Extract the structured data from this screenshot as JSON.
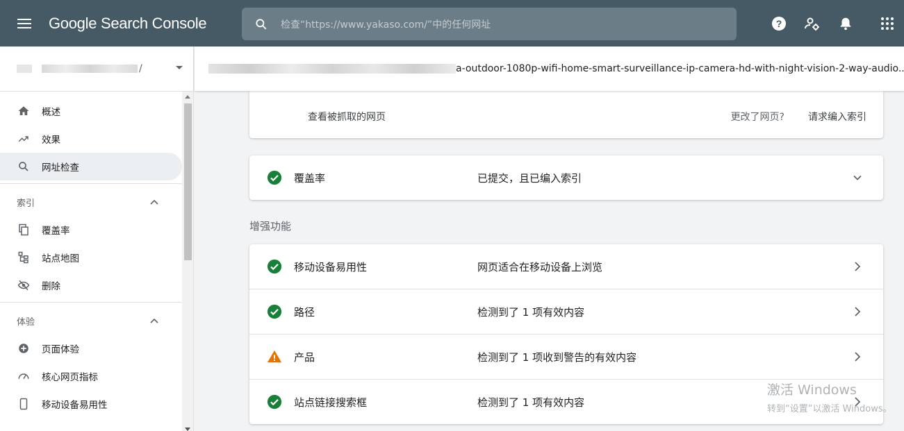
{
  "app": {
    "title": "Google Search Console",
    "search_placeholder": "检查“https://www.yakaso.com/”中的任何网址"
  },
  "property": {
    "suffix": "/"
  },
  "nav": {
    "top_items": [
      {
        "label": "概述",
        "icon": "home-icon"
      },
      {
        "label": "效果",
        "icon": "trending-up-icon"
      },
      {
        "label": "网址检查",
        "icon": "search-icon",
        "active": true
      }
    ],
    "sections": [
      {
        "title": "索引",
        "items": [
          {
            "label": "覆盖率",
            "icon": "copy-icon"
          },
          {
            "label": "站点地图",
            "icon": "sitemap-icon"
          },
          {
            "label": "删除",
            "icon": "visibility-off-icon"
          }
        ]
      },
      {
        "title": "体验",
        "items": [
          {
            "label": "页面体验",
            "icon": "add-circle-icon"
          },
          {
            "label": "核心网页指标",
            "icon": "speed-icon"
          },
          {
            "label": "移动设备易用性",
            "icon": "smartphone-icon"
          }
        ]
      }
    ]
  },
  "url_header": {
    "visible_text": "a-outdoor-1080p-wifi-home-smart-surveillance-ip-camera-hd-with-night-vision-2-way-audio..."
  },
  "fetched_card": {
    "view_crawled": "查看被抓取的网页",
    "page_changed": "更改了网页?",
    "request_indexing": "请求编入索引"
  },
  "coverage": {
    "label": "覆盖率",
    "value": "已提交，且已编入索引",
    "status": "valid"
  },
  "enhancements": {
    "title": "增强功能",
    "rows": [
      {
        "label": "移动设备易用性",
        "value": "网页适合在移动设备上浏览",
        "status": "valid"
      },
      {
        "label": "路径",
        "value": "检测到了 1 项有效内容",
        "status": "valid"
      },
      {
        "label": "产品",
        "value": "检测到了 1 项收到警告的有效内容",
        "status": "warning"
      },
      {
        "label": "站点链接搜索框",
        "value": "检测到了 1 项有效内容",
        "status": "valid"
      }
    ]
  },
  "watermark": {
    "line1": "激活 Windows",
    "line2": "转到“设置”以激活 Windows。"
  },
  "colors": {
    "topbar": "#455a64",
    "valid": "#188038",
    "warning": "#e37400"
  }
}
